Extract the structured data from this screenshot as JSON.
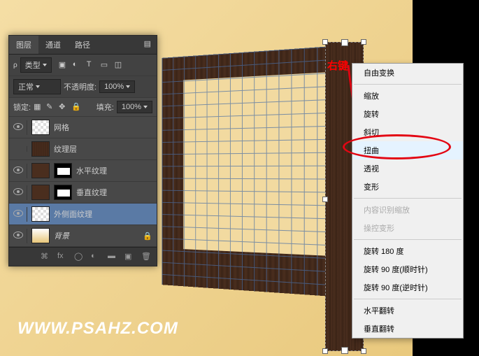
{
  "panel": {
    "tabs": [
      "图层",
      "通道",
      "路径"
    ],
    "kind_label": "类型",
    "blend_mode": "正常",
    "opacity_label": "不透明度:",
    "opacity_value": "100%",
    "lock_label": "锁定:",
    "fill_label": "填充:",
    "fill_value": "100%"
  },
  "layers": [
    {
      "name": "网格"
    },
    {
      "name": "纹理层"
    },
    {
      "name": "水平纹理"
    },
    {
      "name": "垂直纹理"
    },
    {
      "name": "外侧面纹理"
    },
    {
      "name": "背景"
    }
  ],
  "context_menu": {
    "items": [
      {
        "label": "自由变换",
        "sep_after": true
      },
      {
        "label": "缩放"
      },
      {
        "label": "旋转"
      },
      {
        "label": "斜切"
      },
      {
        "label": "扭曲",
        "highlight": true
      },
      {
        "label": "透视"
      },
      {
        "label": "变形",
        "sep_after": true
      },
      {
        "label": "内容识别缩放",
        "disabled": true
      },
      {
        "label": "操控变形",
        "disabled": true,
        "sep_after": true
      },
      {
        "label": "旋转 180 度"
      },
      {
        "label": "旋转 90 度(顺时针)"
      },
      {
        "label": "旋转 90 度(逆时针)",
        "sep_after": true
      },
      {
        "label": "水平翻转"
      },
      {
        "label": "垂直翻转"
      }
    ]
  },
  "annotation": {
    "right_click": "右键"
  },
  "watermark": "WWW.PSAHZ.COM"
}
